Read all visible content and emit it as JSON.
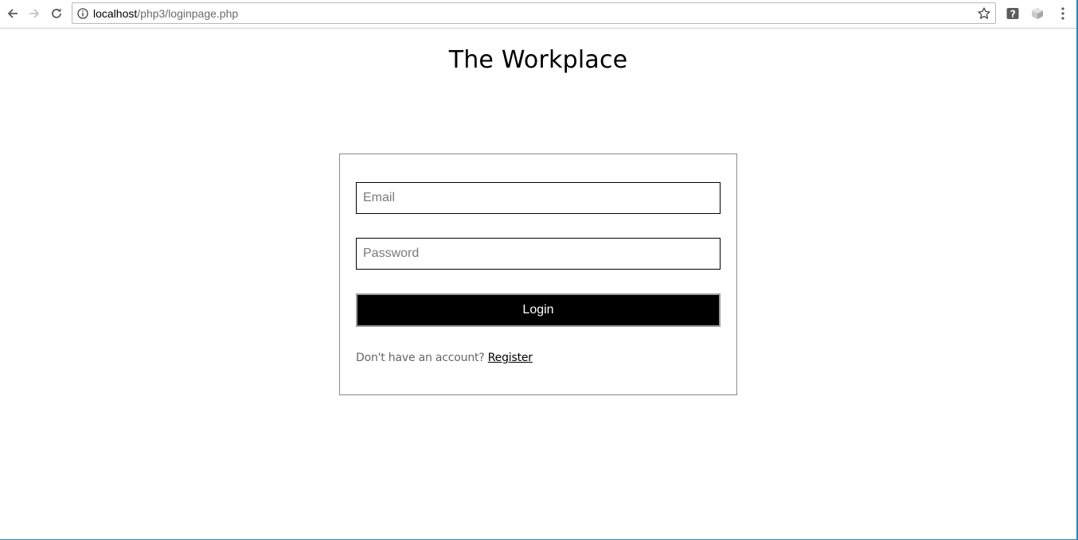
{
  "browser": {
    "url_host": "localhost",
    "url_path": "/php3/loginpage.php",
    "icons": {
      "back": "arrow-left-icon",
      "forward": "arrow-right-icon",
      "reload": "reload-icon",
      "info": "info-icon",
      "bookmark": "star-icon",
      "extension1": "extension-icon",
      "extension2": "extension-icon",
      "menu": "more-vert-icon"
    }
  },
  "page": {
    "title": "The Workplace"
  },
  "login_form": {
    "email_placeholder": "Email",
    "password_placeholder": "Password",
    "login_label": "Login",
    "register_prompt": "Don't have an account?",
    "register_link": "Register"
  },
  "colors": {
    "button_bg": "#000000",
    "button_text": "#ffffff",
    "window_border": "#2f86b5"
  }
}
